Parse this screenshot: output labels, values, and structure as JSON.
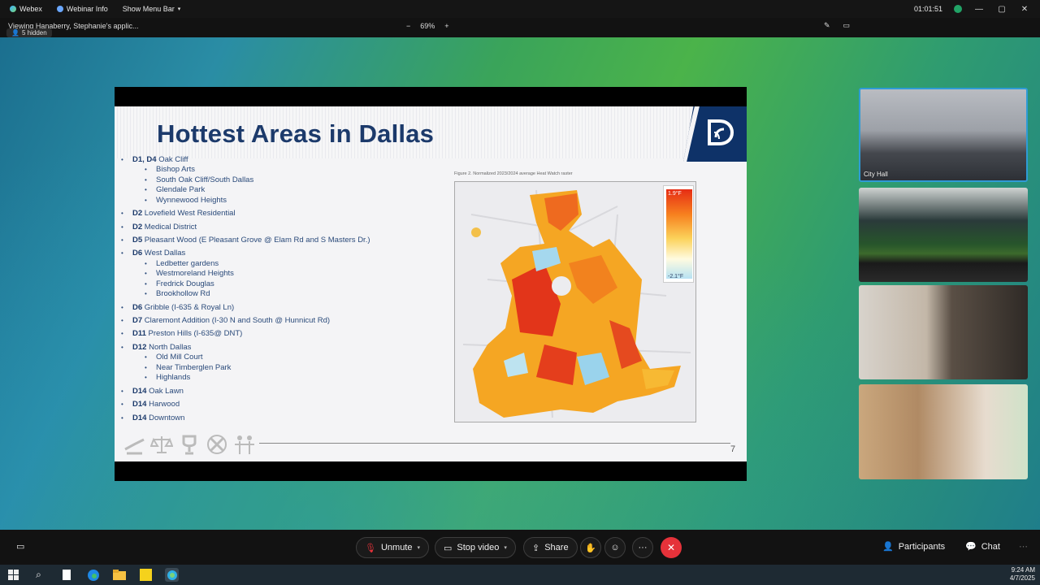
{
  "titlebar": {
    "app_name": "Webex",
    "webinar_info": "Webinar Info",
    "show_menu": "Show Menu Bar",
    "timer": "01:01:51"
  },
  "toolbar2": {
    "viewing": "Viewing Hanaberry, Stephanie's applic...",
    "hidden": "5 hidden",
    "zoom_out": "−",
    "zoom": "69%",
    "zoom_in": "+"
  },
  "slide": {
    "title": "Hottest Areas in Dallas",
    "page_number": "7",
    "map_caption": "Figure 2. Normalized 2023/2024 average Heat Watch raster",
    "legend_high": "1.9°F",
    "legend_low": "-2.1°F",
    "districts": [
      {
        "district": "D1, D4",
        "name": "Oak Cliff",
        "subitems": [
          "Bishop Arts",
          "South Oak Cliff/South Dallas",
          "Glendale Park",
          "Wynnewood Heights"
        ]
      },
      {
        "district": "D2",
        "name": "Lovefield West Residential",
        "subitems": []
      },
      {
        "district": "D2",
        "name": "Medical District",
        "subitems": []
      },
      {
        "district": "D5",
        "name": "Pleasant Wood (E Pleasant Grove @ Elam Rd and S Masters Dr.)",
        "subitems": []
      },
      {
        "district": "D6",
        "name": "West Dallas",
        "subitems": [
          "Ledbetter gardens",
          "Westmoreland Heights",
          "Fredrick Douglas",
          "Brookhollow Rd"
        ]
      },
      {
        "district": "D6",
        "name": "Gribble (I-635 & Royal Ln)",
        "subitems": []
      },
      {
        "district": "D7",
        "name": "Claremont Addition (I-30 N and South @ Hunnicut Rd)",
        "subitems": []
      },
      {
        "district": "D11",
        "name": "Preston Hills (I-635@ DNT)",
        "subitems": []
      },
      {
        "district": "D12",
        "name": "North Dallas",
        "subitems": [
          "Old Mill Court",
          "Near Timberglen Park",
          "Highlands"
        ]
      },
      {
        "district": "D14",
        "name": "Oak Lawn",
        "subitems": []
      },
      {
        "district": "D14",
        "name": "Harwood",
        "subitems": []
      },
      {
        "district": "D14",
        "name": "Downtown",
        "subitems": []
      }
    ]
  },
  "participants_tiles": {
    "tile1_label": "City Hall"
  },
  "controls": {
    "unmute": "Unmute",
    "stop_video": "Stop video",
    "share": "Share",
    "participants": "Participants",
    "chat": "Chat",
    "end_icon": "close-icon"
  },
  "taskbar": {
    "time": "9:24 AM",
    "date": "4/7/2025"
  },
  "colors": {
    "title_blue": "#1c3a6b",
    "end_red": "#e5323a",
    "active_tile": "#2e9bd6"
  }
}
